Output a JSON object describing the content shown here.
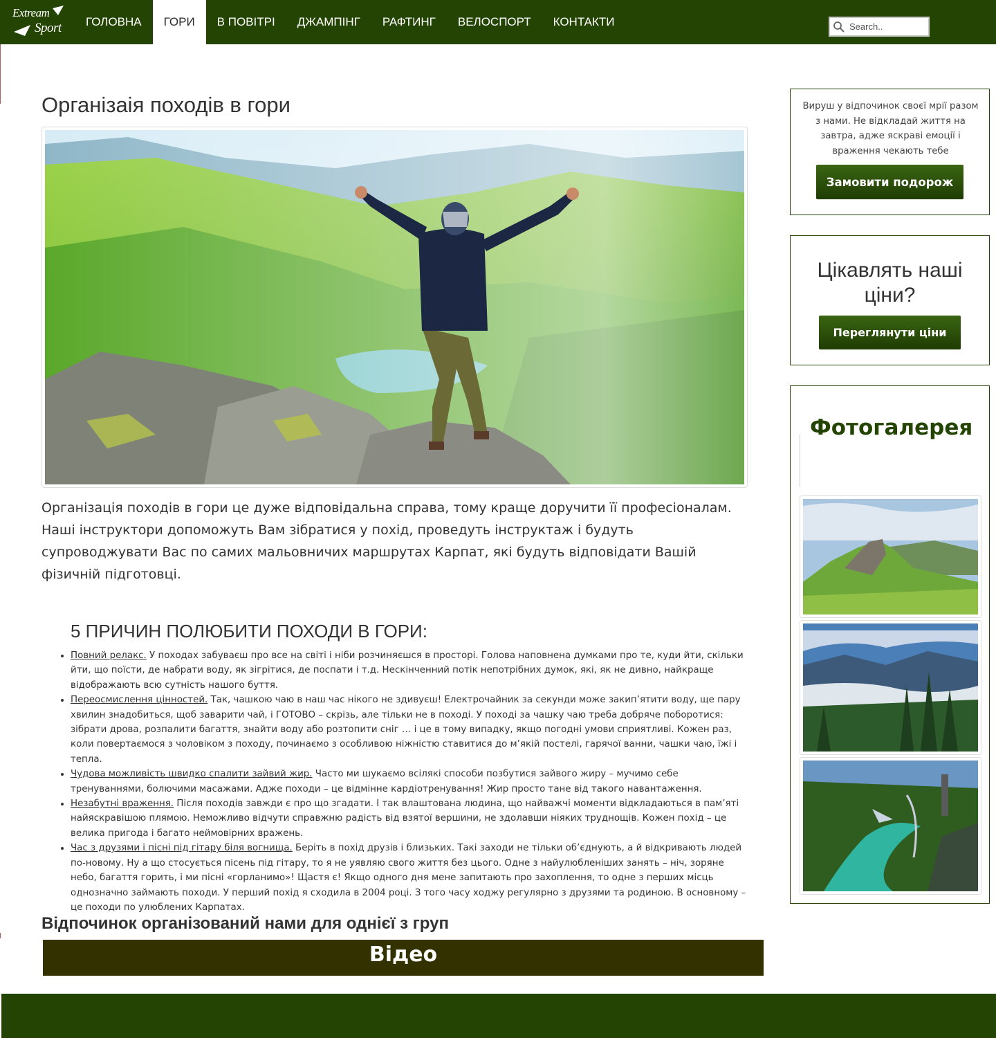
{
  "navbar": {
    "logo": {
      "line1": "Extream",
      "line2": "Sport"
    },
    "items": [
      {
        "label": "ГОЛОВНА",
        "active": false
      },
      {
        "label": "ГОРИ",
        "active": true
      },
      {
        "label": "В ПОВІТРІ",
        "active": false
      },
      {
        "label": "ДЖАМПІНГ",
        "active": false
      },
      {
        "label": "РАФТИНГ",
        "active": false
      },
      {
        "label": "ВЕЛОСПОРТ",
        "active": false
      },
      {
        "label": "КОНТАКТИ",
        "active": false
      }
    ],
    "search": {
      "placeholder": "Search..",
      "icon": "search-icon"
    }
  },
  "main": {
    "title": "Організаія походів в гори",
    "hero_image": "hiker-arms-raised-on-mountain-peak",
    "intro": "Організація походів в гори це дуже відповідальна справа, тому краще доручити її професіоналам. Наші інструктори допоможуть Вам зібратися у похід, проведуть інструктаж і будуть супроводжувати Вас по самих мальовничих маршрутах Карпат, які будуть відповідати Вашій фізичній підготовці.",
    "reasons_title": "5 ПРИЧИН ПОЛЮБИТИ ПОХОДИ В ГОРИ:",
    "reasons": [
      {
        "lead": "Повний релакс.",
        "text": " У походах забуваєш про все на світі і ніби розчиняєшся в просторі. Голова наповнена думками про те, куди йти, скільки йти, що поїсти, де набрати воду, як зігрітися, де поспати і т.д. Нескінченний потік непотрібних думок, які, як не дивно, найкраще відображають всю сутність нашого буття."
      },
      {
        "lead": "Переосмислення цінностей.",
        "text": " Так, чашкою чаю в наш час нікого не здивуєш! Електрочайник за секунди може закип’ятити воду, ще пару хвилин знадобиться, щоб заварити чай, і ГОТОВО – скрізь, але тільки не в поході. У поході за чашку чаю треба добряче поборотися: зібрати дрова, розпалити багаття, знайти воду або розтопити сніг … і це в тому випадку, якщо погодні умови сприятливі. Кожен раз, коли повертаємося з чоловіком з походу, починаємо з особливою ніжністю ставитися до м’якій постелі, гарячої ванни, чашки чаю, їжі і тепла."
      },
      {
        "lead": "Чудова можливість швидко спалити зайвий жир.",
        "text": " Часто ми шукаємо всілякі способи позбутися зайвого жиру – мучимо себе тренуваннями, болючими масажами. Адже походи – це відмінне кардіотренування! Жир просто тане від такого навантаження."
      },
      {
        "lead": "Незабутні враження.",
        "text": " Після походів завжди є про що згадати. І так влаштована людина, що найважчі моменти відкладаються в пам’яті найяскравішою плямою. Неможливо відчути справжню радість від взятої вершини, не здолавши ніяких труднощів. Кожен похід – це велика пригода і багато неймовірних вражень."
      },
      {
        "lead": "Час з друзями і пісні під гітару біля вогнища.",
        "text": " Беріть в похід друзів і близьких. Такі заходи не тільки об’єднують, а й відкривають людей по-новому. Ну а що стосується пісень під гітару, то я не уявляю свого життя без цього. Одне з найулюбленіших занять – ніч, зоряне небо, багаття горить, і ми пісні «горланимо»! Щастя є! Якщо одного дня мене запитають про захоплення, то одне з перших місць однозначно займають походи. У перший похід я сходила в 2004 році. З того часу ходжу регулярно з друзями та родиною. В основному – це походи по улюблених Карпатах."
      }
    ],
    "group_title": "Відпочинок організований нами для однієї з груп",
    "video_label": "Відео"
  },
  "sidebar": {
    "promo_text": "Вируш у відпочинок своєї мрії разом з нами. Не відкладай життя на завтра, адже яскраві емоції і враження чекають тебе",
    "order_button": "Замовити подорож",
    "prices_question": "Цікавлять наші ціни?",
    "prices_button": "Переглянути ціни",
    "gallery_title": "Фотогалерея",
    "gallery": [
      "mountain-ridge-rock-photo",
      "misty-valley-forest-photo",
      "bungee-jump-river-canyon-photo"
    ]
  },
  "colors": {
    "brand_green": "#244403",
    "video_bar": "#333100",
    "text": "#333333"
  }
}
